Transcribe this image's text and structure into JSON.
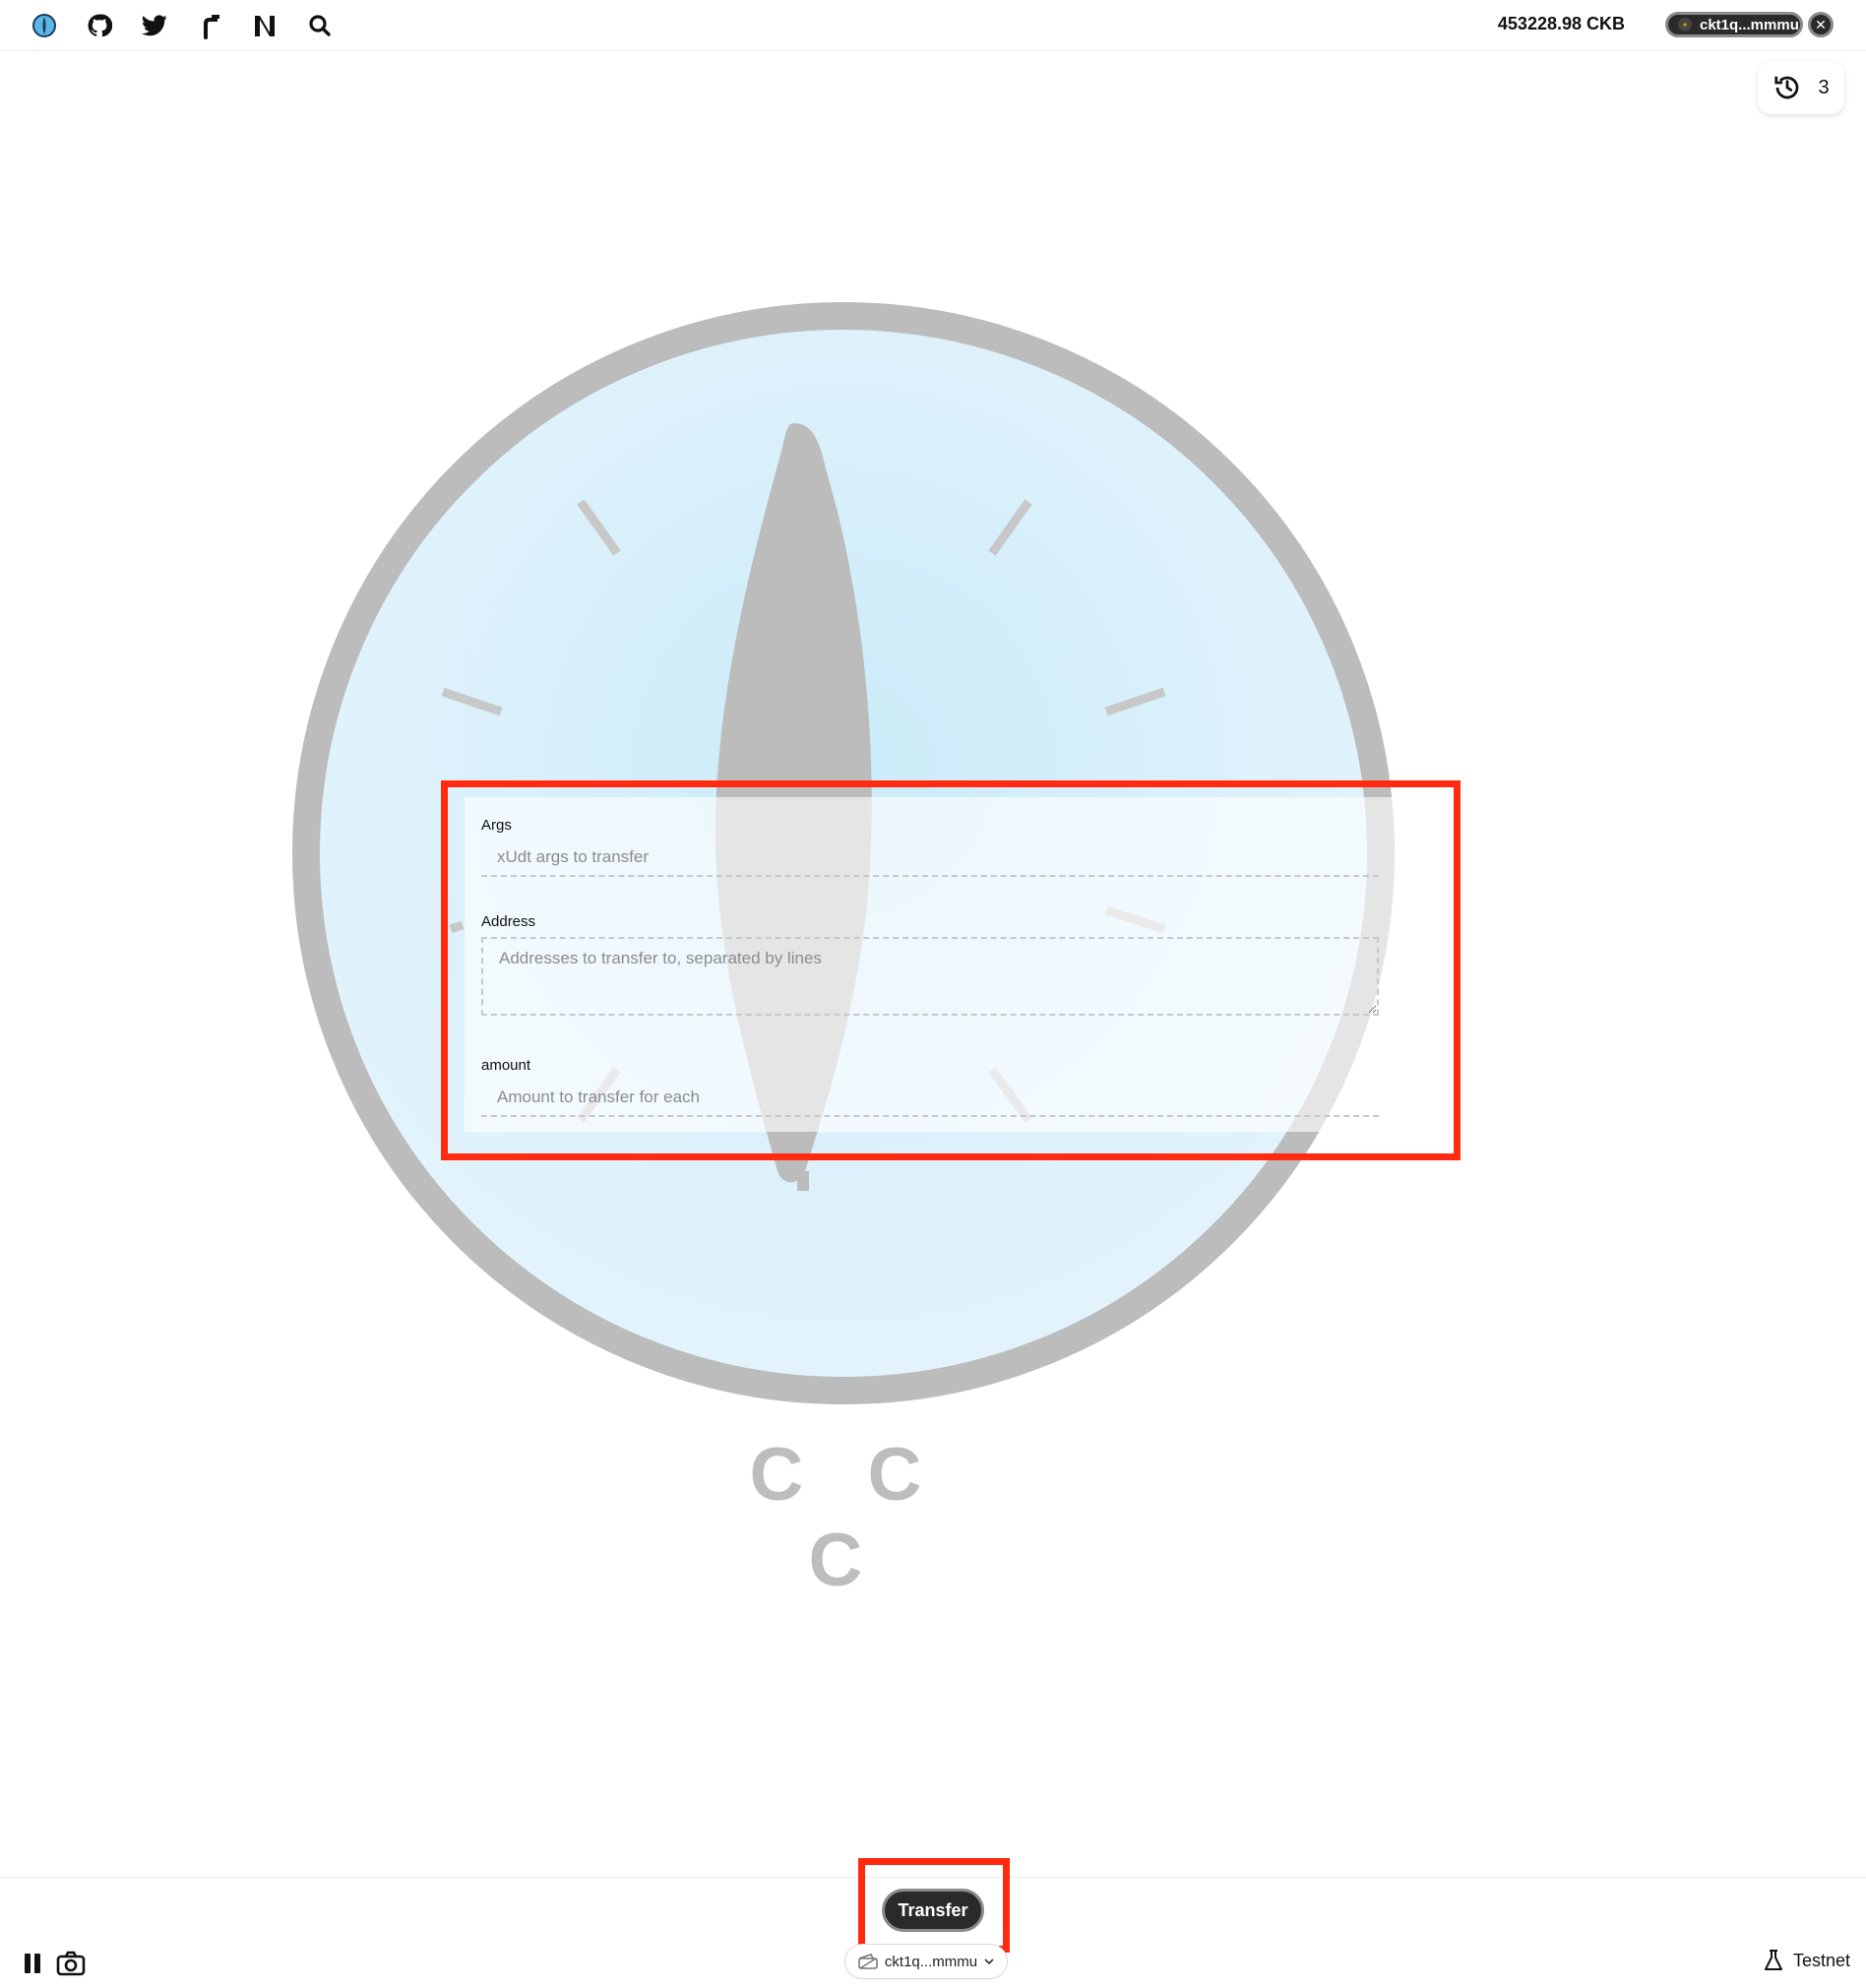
{
  "header": {
    "icons": [
      "app-logo-icon",
      "github-icon",
      "twitter-icon",
      "faucet-icon",
      "nervos-icon",
      "search-icon"
    ],
    "balance": "453228.98 CKB",
    "wallet_address": "ckt1q...mmmu",
    "history_count": "3"
  },
  "background": {
    "title": "C C C"
  },
  "form": {
    "args": {
      "label": "Args",
      "placeholder": "xUdt args to transfer"
    },
    "address": {
      "label": "Address",
      "placeholder": "Addresses to transfer to, separated by lines"
    },
    "amount": {
      "label": "amount",
      "placeholder": "Amount to transfer for each"
    }
  },
  "footer": {
    "transfer_label": "Transfer",
    "address_selector": "ckt1q...mmmu",
    "network": "Testnet"
  },
  "colors": {
    "highlight": "#ff2a10",
    "dial": "#dff2fb",
    "dial_rim": "#bcbcbc"
  }
}
